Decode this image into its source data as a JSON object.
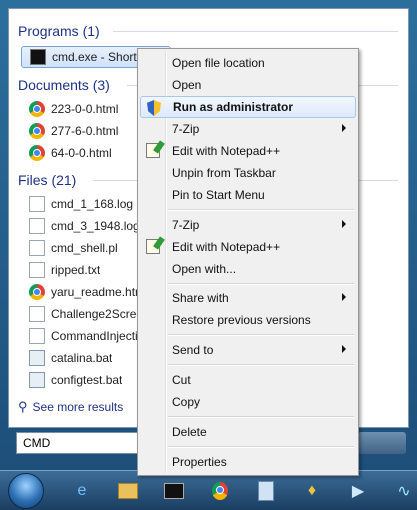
{
  "start_menu": {
    "programs": {
      "title": "Programs (1)",
      "items": [
        {
          "label": "cmd.exe - Shortcut",
          "icon": "cmd-icon"
        }
      ]
    },
    "documents": {
      "title": "Documents (3)",
      "items": [
        {
          "label": "223-0-0.html",
          "icon": "chrome-icon"
        },
        {
          "label": "277-6-0.html",
          "icon": "chrome-icon"
        },
        {
          "label": "64-0-0.html",
          "icon": "chrome-icon"
        }
      ]
    },
    "files": {
      "title": "Files (21)",
      "items": [
        {
          "label": "cmd_1_168.log",
          "icon": "text-file-icon"
        },
        {
          "label": "cmd_3_1948.log",
          "icon": "text-file-icon"
        },
        {
          "label": "cmd_shell.pl",
          "icon": "text-file-icon"
        },
        {
          "label": "ripped.txt",
          "icon": "text-file-icon"
        },
        {
          "label": "yaru_readme.html",
          "icon": "chrome-icon"
        },
        {
          "label": "Challenge2Screenshot",
          "icon": "text-file-icon"
        },
        {
          "label": "CommandInjection",
          "icon": "text-file-icon"
        },
        {
          "label": "catalina.bat",
          "icon": "batch-file-icon"
        },
        {
          "label": "configtest.bat",
          "icon": "batch-file-icon"
        }
      ]
    },
    "see_more": "See more results",
    "search_value": "CMD"
  },
  "context_menu": {
    "groups": [
      [
        {
          "label": "Open file location"
        },
        {
          "label": "Open"
        },
        {
          "label": "Run as administrator",
          "icon": "uac-shield-icon",
          "highlighted": true
        },
        {
          "label": "7-Zip",
          "submenu": true
        },
        {
          "label": "Edit with Notepad++",
          "icon": "notepad-plus-plus-icon"
        },
        {
          "label": "Unpin from Taskbar"
        },
        {
          "label": "Pin to Start Menu"
        }
      ],
      [
        {
          "label": "7-Zip",
          "submenu": true
        },
        {
          "label": "Edit with Notepad++",
          "icon": "notepad-plus-plus-icon"
        },
        {
          "label": "Open with..."
        }
      ],
      [
        {
          "label": "Share with",
          "submenu": true
        },
        {
          "label": "Restore previous versions"
        }
      ],
      [
        {
          "label": "Send to",
          "submenu": true
        }
      ],
      [
        {
          "label": "Cut"
        },
        {
          "label": "Copy"
        }
      ],
      [
        {
          "label": "Delete"
        }
      ],
      [
        {
          "label": "Properties"
        }
      ]
    ]
  },
  "taskbar": {
    "icons": [
      "internet-explorer-icon",
      "folder-icon",
      "cmd-icon",
      "chrome-icon",
      "notepad-icon",
      "puzzle-icon",
      "media-icon",
      "chart-icon",
      "pulse-icon",
      "gear-icon"
    ]
  },
  "colors": {
    "section_title": "#1e3287",
    "selection_border": "#7da2ce",
    "menu_highlight_border": "#a8c6ee"
  }
}
